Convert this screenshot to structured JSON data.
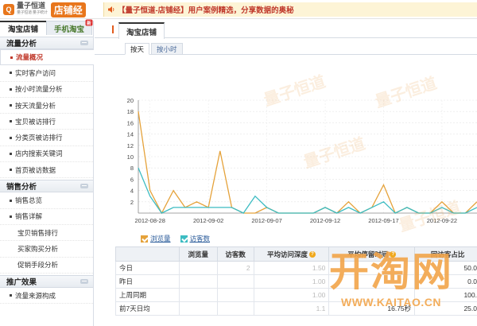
{
  "header": {
    "logo_text": "量子恒道",
    "logo_sub": "量子恒道  量子统计",
    "badge": "店铺经",
    "announcement": "【量子恒道-店铺经】用户案例精选，分享数据的奥秘"
  },
  "sidebar": {
    "tabs": [
      {
        "label": "淘宝店铺"
      },
      {
        "label": "手机淘宝",
        "badge": "新"
      }
    ],
    "sections": [
      {
        "title": "流量分析",
        "items": [
          "流量概况",
          "实时客户访问",
          "按小时流量分析",
          "按天流量分析",
          "宝贝被访排行",
          "分类页被访排行",
          "店内搜索关键词",
          "首页被访数据"
        ]
      },
      {
        "title": "销售分析",
        "items": [
          "销售总览",
          "销售详解",
          "宝贝销售排行",
          "买家购买分析",
          "促销手段分析"
        ]
      },
      {
        "title": "推广效果",
        "items": [
          "流量来源构成"
        ]
      }
    ]
  },
  "main": {
    "tab": "淘宝店铺",
    "subtabs": [
      "按天",
      "按小时"
    ]
  },
  "chart_data": {
    "type": "line",
    "x": [
      "2012-08-27",
      "2012-08-28",
      "2012-08-29",
      "2012-08-30",
      "2012-08-31",
      "2012-09-01",
      "2012-09-02",
      "2012-09-03",
      "2012-09-04",
      "2012-09-05",
      "2012-09-06",
      "2012-09-07",
      "2012-09-08",
      "2012-09-09",
      "2012-09-10",
      "2012-09-11",
      "2012-09-12",
      "2012-09-13",
      "2012-09-14",
      "2012-09-15",
      "2012-09-16",
      "2012-09-17",
      "2012-09-18",
      "2012-09-19",
      "2012-09-20",
      "2012-09-21",
      "2012-09-22",
      "2012-09-23",
      "2012-09-24",
      "2012-09-25"
    ],
    "x_tick_labels": [
      "2012-08-28",
      "2012-09-02",
      "2012-09-07",
      "2012-09-12",
      "2012-09-17",
      "2012-09-22"
    ],
    "ylim": [
      0,
      20
    ],
    "yticks": [
      2,
      4,
      6,
      8,
      10,
      12,
      14,
      16,
      18,
      20
    ],
    "grid": true,
    "series": [
      {
        "name": "浏览量",
        "color": "#e5a23a",
        "values": [
          18,
          4,
          0,
          4,
          1,
          2,
          1,
          11,
          1,
          0,
          0,
          1,
          0,
          0,
          0,
          0,
          1,
          0,
          2,
          0,
          1,
          5,
          0,
          1,
          0,
          0,
          2,
          0,
          0,
          2
        ]
      },
      {
        "name": "访客数",
        "color": "#3cbcc2",
        "values": [
          8,
          3,
          0,
          1,
          1,
          1,
          1,
          1,
          1,
          0,
          3,
          1,
          0,
          0,
          0,
          0,
          1,
          0,
          1,
          0,
          1,
          2,
          0,
          1,
          0,
          0,
          1,
          0,
          0,
          1
        ]
      }
    ]
  },
  "table": {
    "headers": [
      "",
      "浏览量",
      "访客数",
      "平均访问深度",
      "平均停留时间",
      "回访客占比"
    ],
    "rows": [
      {
        "label": "今日",
        "cells": [
          "",
          "2",
          "1.50",
          "",
          "50.0"
        ]
      },
      {
        "label": "昨日",
        "cells": [
          "",
          "",
          "1.00",
          "",
          "0.0"
        ]
      },
      {
        "label": "上周同期",
        "cells": [
          "",
          "",
          "1.00",
          "",
          "100."
        ]
      },
      {
        "label": "前7天日均",
        "cells": [
          "",
          "",
          "1.1",
          "16.75秒",
          "25.0"
        ]
      }
    ]
  },
  "watermark": {
    "text": "量子恒道",
    "site_logo": "开淘网",
    "site_url": "WWW.KAITAO.CN"
  }
}
